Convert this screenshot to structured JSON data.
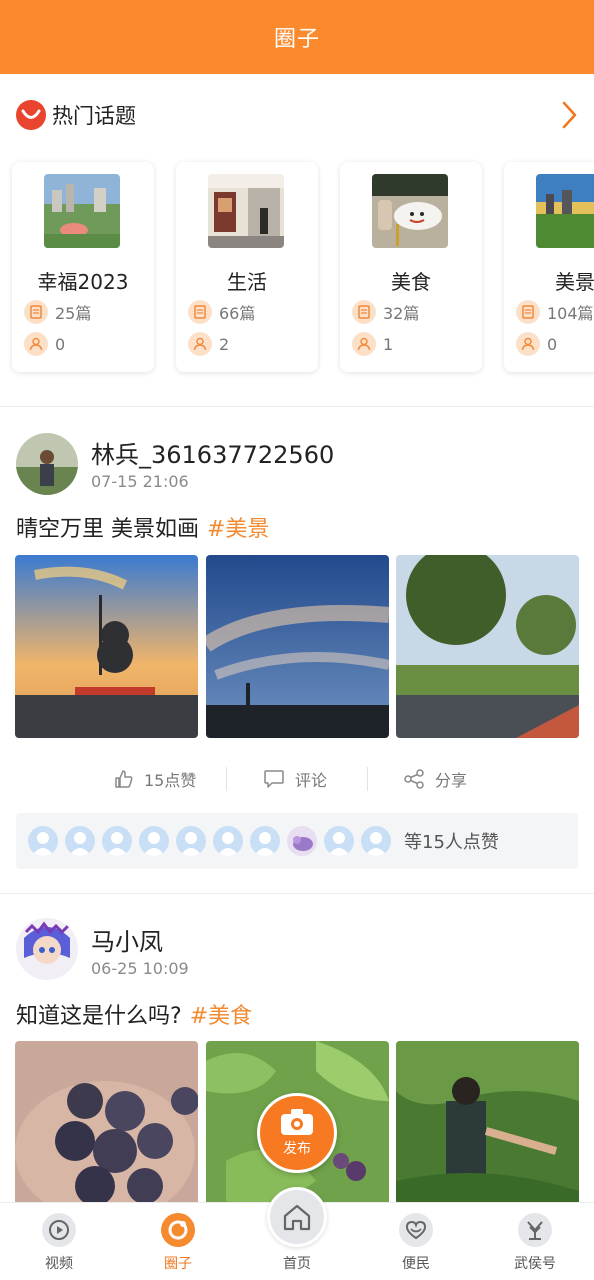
{
  "header": {
    "title": "圈子"
  },
  "hot_topics": {
    "title": "热门话题",
    "items": [
      {
        "name": "幸福2023",
        "posts": "25篇",
        "followers": "0"
      },
      {
        "name": "生活",
        "posts": "66篇",
        "followers": "2"
      },
      {
        "name": "美食",
        "posts": "32篇",
        "followers": "1"
      },
      {
        "name": "美景",
        "posts": "104篇",
        "followers": "0"
      }
    ]
  },
  "posts": [
    {
      "author": "林兵_361637722560",
      "time": "07-15 21:06",
      "text": "晴空万里 美景如画",
      "tag": "#美景",
      "actions": {
        "like": "15点赞",
        "comment": "评论",
        "share": "分享"
      },
      "likers_text": "等15人点赞"
    },
    {
      "author": "马小凤",
      "time": "06-25 10:09",
      "text": "知道这是什么吗?",
      "tag": "#美食"
    }
  ],
  "publish_button": {
    "label": "发布"
  },
  "bottom_nav": {
    "active": "圈子",
    "items": [
      {
        "label": "视频",
        "icon": "video-play-icon"
      },
      {
        "label": "圈子",
        "icon": "circle-icon"
      },
      {
        "label": "首页",
        "icon": "home-icon"
      },
      {
        "label": "便民",
        "icon": "heart-hands-icon"
      },
      {
        "label": "武侯号",
        "icon": "wuhou-icon"
      }
    ]
  },
  "colors": {
    "accent": "#fb8a2e",
    "tag": "#f28a30",
    "hot_logo": "#e9452e"
  }
}
